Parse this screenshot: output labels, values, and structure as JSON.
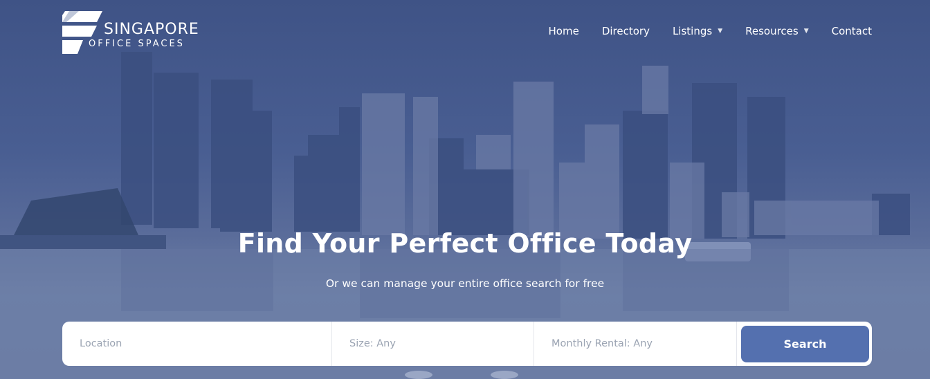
{
  "brand": {
    "name_line1": "SINGAPORE",
    "name_line2": "OFFICE SPACES"
  },
  "nav": {
    "items": [
      {
        "label": "Home",
        "has_dropdown": false
      },
      {
        "label": "Directory",
        "has_dropdown": false
      },
      {
        "label": "Listings",
        "has_dropdown": true
      },
      {
        "label": "Resources",
        "has_dropdown": true
      },
      {
        "label": "Contact",
        "has_dropdown": false
      }
    ]
  },
  "hero": {
    "headline": "Find Your Perfect Office Today",
    "subheadline": "Or we can manage your entire office search for free",
    "background": "singapore-skyline-photo"
  },
  "search": {
    "location_placeholder": "Location",
    "size_value": "Size: Any",
    "rental_value": "Monthly Rental: Any",
    "button_label": "Search"
  },
  "colors": {
    "overlay": "#495e92",
    "accent_button": "#5470af",
    "text_light": "#ffffff",
    "placeholder": "#9aa3b2"
  }
}
